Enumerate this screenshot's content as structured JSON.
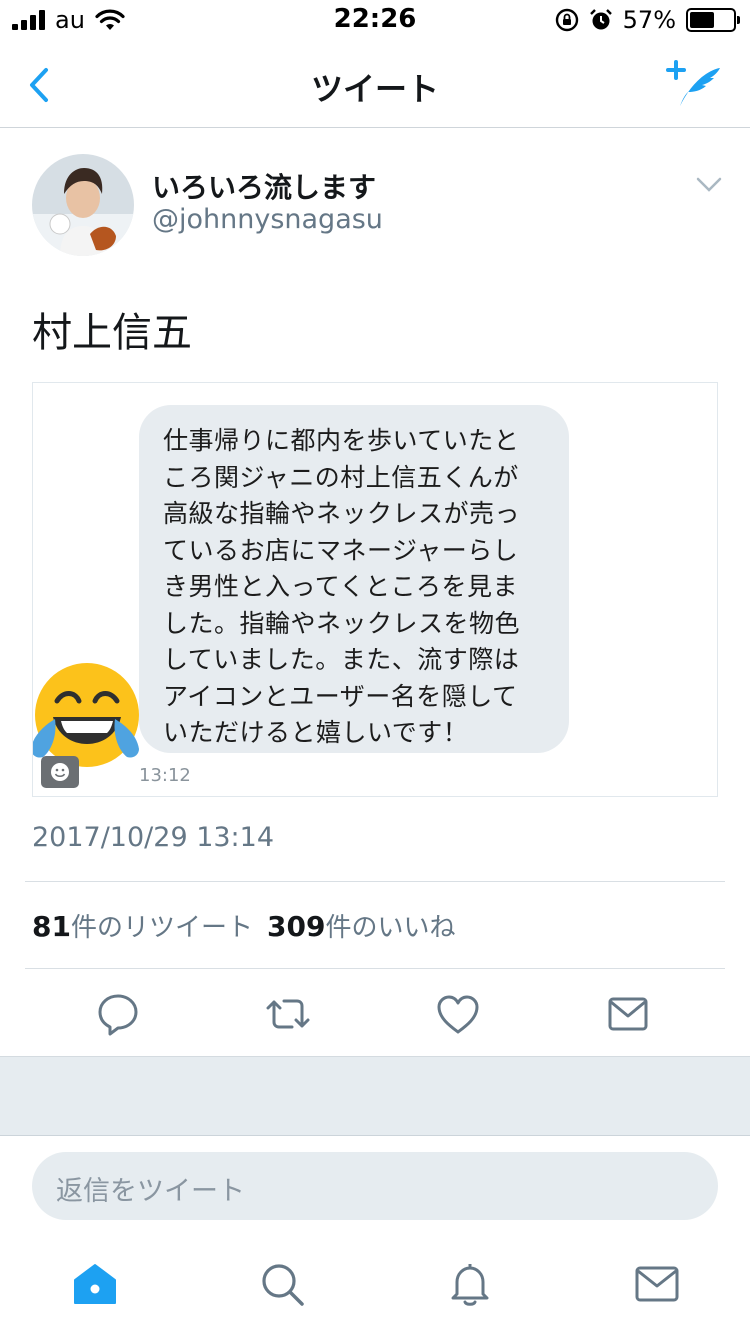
{
  "status_bar": {
    "carrier": "au",
    "time": "22:26",
    "battery_percent": "57%",
    "battery_level": 0.57
  },
  "nav": {
    "title": "ツイート",
    "back_icon": "chevron-left-icon",
    "compose_icon": "compose-tweet-icon"
  },
  "tweet": {
    "display_name": "いろいろ流します",
    "handle": "@johnnysnagasu",
    "text": "村上信五",
    "media": {
      "bubble_lines": [
        "仕事帰りに都内を歩いていたと",
        "ころ関ジャニの村上信五くんが",
        "高級な指輪やネックレスが売っ",
        "ているお店にマネージャーらし",
        "き男性と入ってくところを見ま",
        "した。指輪やネックレスを物色",
        "していました。また、流す際は",
        "アイコンとユーザー名を隠して",
        "いただけると嬉しいです！"
      ],
      "bubble_time": "13:12",
      "emoji": "tears-of-joy-emoji-icon"
    },
    "timestamp": "2017/10/29 13:14",
    "retweet_count": "81",
    "retweet_label": "件のリツイート",
    "like_count": "309",
    "like_label": "件のいいね"
  },
  "actions": [
    "reply-icon",
    "retweet-icon",
    "like-icon",
    "direct-message-icon"
  ],
  "reply": {
    "placeholder": "返信をツイート"
  },
  "tab_bar": [
    "home-icon",
    "search-icon",
    "notifications-icon",
    "messages-icon"
  ],
  "colors": {
    "accent": "#1da1f2",
    "text": "#14171a",
    "secondary": "#657786",
    "band": "#e6ecf0"
  }
}
